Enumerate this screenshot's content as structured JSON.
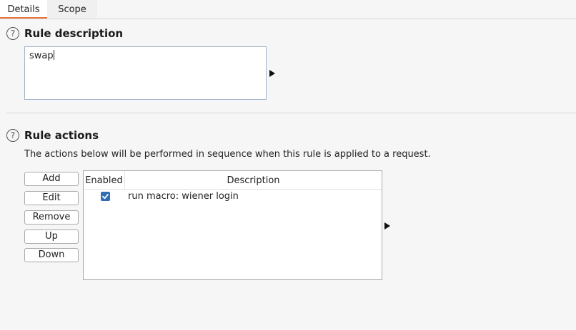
{
  "tabs": [
    {
      "label": "Details",
      "active": true
    },
    {
      "label": "Scope",
      "active": false
    }
  ],
  "rule_description": {
    "title": "Rule description",
    "value": "swap"
  },
  "rule_actions": {
    "title": "Rule actions",
    "info": "The actions below will be performed in sequence when this rule is applied to a request.",
    "buttons": {
      "add": "Add",
      "edit": "Edit",
      "remove": "Remove",
      "up": "Up",
      "down": "Down"
    },
    "table": {
      "headers": {
        "enabled": "Enabled",
        "description": "Description"
      },
      "rows": [
        {
          "enabled": true,
          "description": "run macro: wiener login"
        }
      ]
    }
  },
  "icons": {
    "help": "help-circle-icon",
    "expand": "expand-arrow-icon",
    "check": "checkbox-checked-icon"
  },
  "colors": {
    "accent_tab_underline": "#e8733a",
    "checkbox_fill": "#2f6fb5"
  }
}
